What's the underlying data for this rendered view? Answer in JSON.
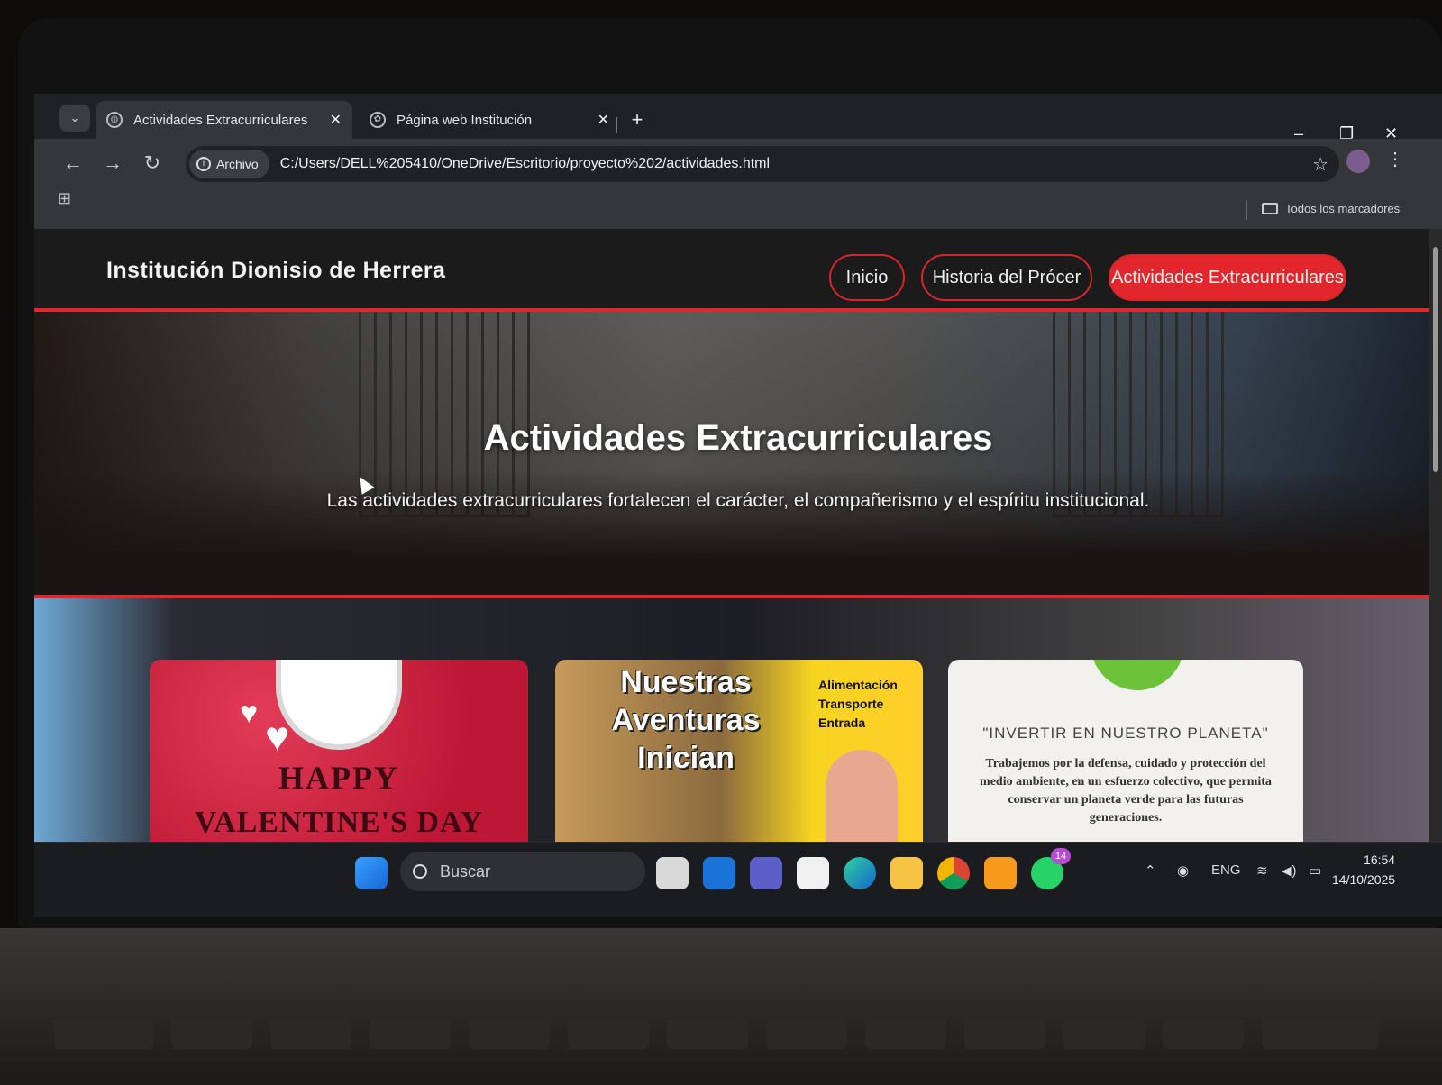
{
  "browser": {
    "tabs": [
      {
        "label": "Actividades Extracurriculares"
      },
      {
        "label": "Página web Institución"
      }
    ],
    "security_chip": "Archivo",
    "url": "C:/Users/DELL%205410/OneDrive/Escritorio/proyecto%202/actividades.html",
    "bookmarks_all": "Todos los marcadores"
  },
  "site": {
    "brand": "Institución Dionisio de Herrera",
    "nav": [
      "Inicio",
      "Historia del Prócer",
      "Actividades Extracurriculares"
    ],
    "active_nav_index": 2,
    "hero_title": "Actividades Extracurriculares",
    "hero_subtitle": "Las actividades extracurriculares fortalecen el carácter, el compañerismo y el espíritu institucional.",
    "accent_color": "#e3262b"
  },
  "cards": {
    "valentine": {
      "line1": "HAPPY",
      "line2": "VALENTINE'S DAY"
    },
    "adventure": {
      "title": "Nuestras Aventuras Inician",
      "list": [
        "Alimentación",
        "Transporte",
        "Entrada"
      ]
    },
    "planet": {
      "quote": "\"INVERTIR EN NUESTRO PLANETA\"",
      "text": "Trabajemos por la defensa, cuidado y protección del medio ambiente, en un esfuerzo colectivo, que permita conservar un planeta verde para las futuras generaciones."
    }
  },
  "taskbar": {
    "search_placeholder": "Buscar",
    "language": "ENG",
    "whatsapp_badge": "14",
    "time": "16:54",
    "date": "14/10/2025"
  }
}
